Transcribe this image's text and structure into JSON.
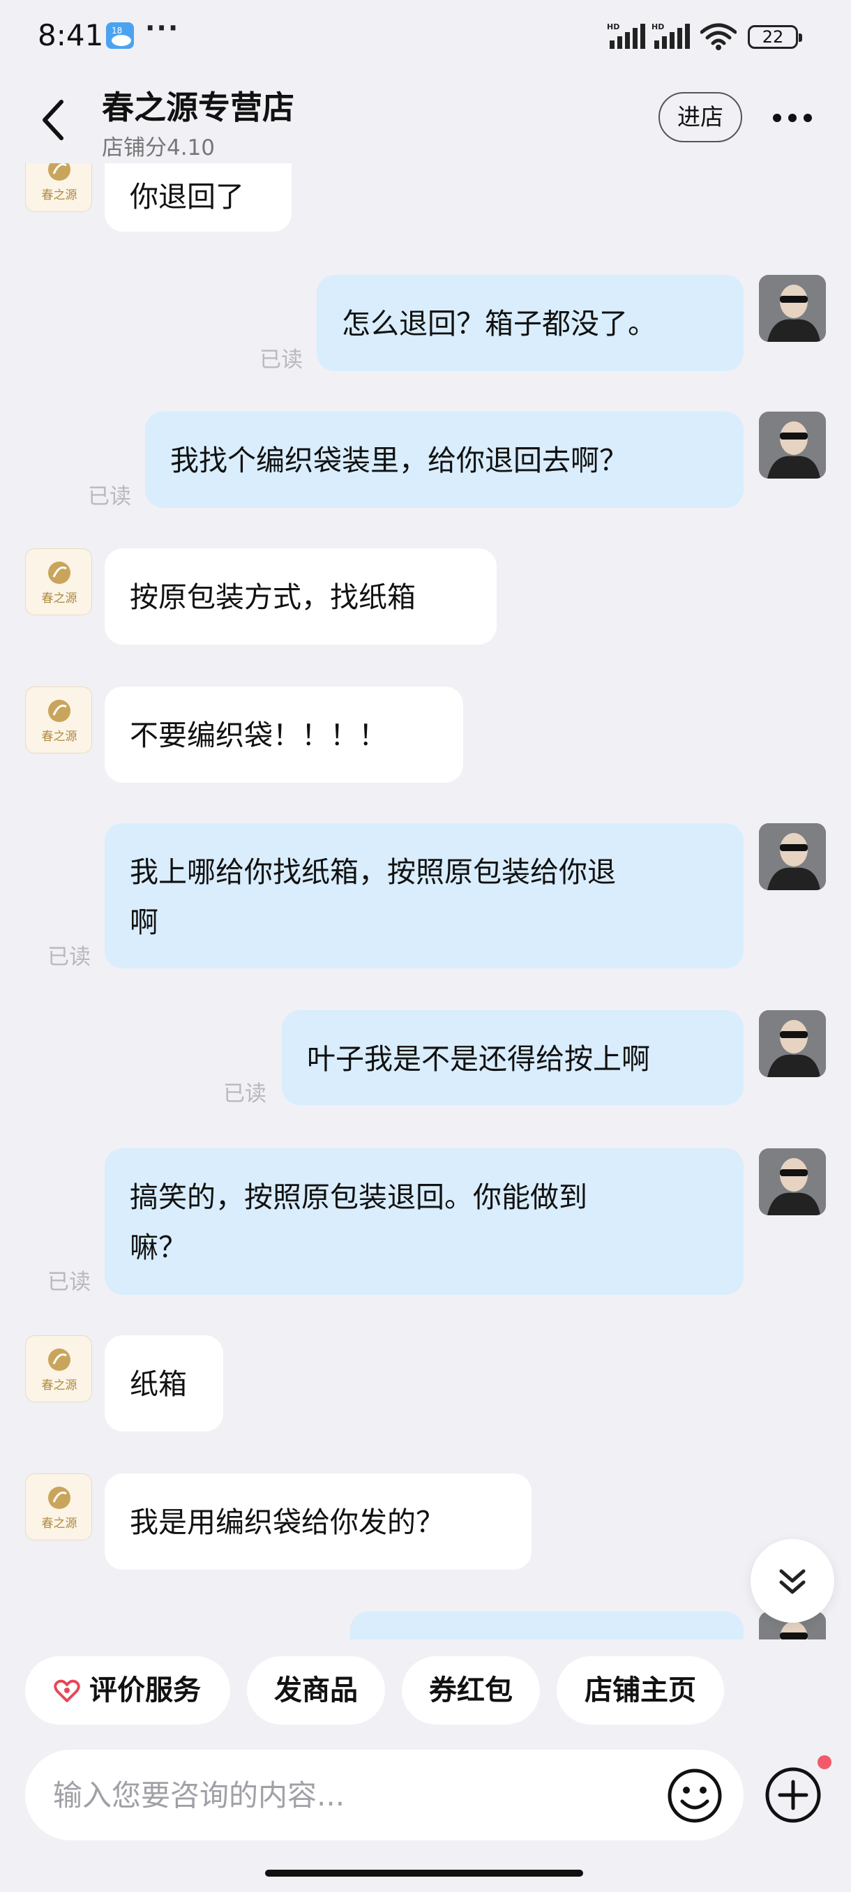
{
  "status_bar": {
    "time": "8:41",
    "weather_badge": "18",
    "more": "···",
    "battery": "22"
  },
  "header": {
    "title": "春之源专营店",
    "score": "店铺分4.10",
    "enter_store": "进店"
  },
  "shop_avatar_text": "春之源",
  "messages": [
    {
      "side": "shop",
      "text": "你退回了"
    },
    {
      "side": "me",
      "text": "怎么退回？箱子都没了。",
      "read": "已读"
    },
    {
      "side": "me",
      "text": "我找个编织袋装里，给你退回去啊？",
      "read": "已读"
    },
    {
      "side": "shop",
      "text": "按原包装方式，找纸箱"
    },
    {
      "side": "shop",
      "text": "不要编织袋！！！！"
    },
    {
      "side": "me",
      "text": "我上哪给你找纸箱，按照原包装给你退\n啊",
      "read": "已读"
    },
    {
      "side": "me",
      "text": "叶子我是不是还得给按上啊",
      "read": "已读"
    },
    {
      "side": "me",
      "text": "搞笑的，按照原包装退回。你能做到\n嘛？",
      "read": "已读"
    },
    {
      "side": "shop",
      "text": "纸箱"
    },
    {
      "side": "shop",
      "text": "我是用编织袋给你发的？"
    },
    {
      "side": "me",
      "text": ""
    }
  ],
  "quick_actions": [
    "评价服务",
    "发商品",
    "券红包",
    "店铺主页"
  ],
  "input": {
    "placeholder": "输入您要咨询的内容..."
  },
  "colors": {
    "background": "#f0f0f5",
    "my_bubble": "#d9edfc",
    "shop_bubble": "#ffffff",
    "heart": "#e5485a",
    "badge_dot": "#f25a6a"
  }
}
